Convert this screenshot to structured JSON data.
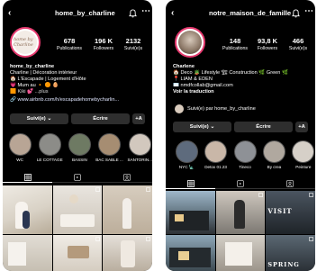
{
  "left": {
    "handle": "home_by_charline",
    "avatar_text": "home by Charline",
    "stats": [
      {
        "value": "678",
        "label": "Publications"
      },
      {
        "value": "196 K",
        "label": "Followers"
      },
      {
        "value": "2132",
        "label": "Suivi(e)s"
      }
    ],
    "bio": {
      "name": "home_by_charline",
      "lines": [
        "Charline | Décoration intérieur",
        "🏠 L'Escapade | Logement d'Hôte",
        "💗 Mum au 🔸 🟠 🥚",
        "🟧 Kiki 💕 ...plus"
      ],
      "link": "www.airbnb.com/h/escapadehomebycharlin..."
    },
    "buttons": {
      "follow": "Suivi(e) ⌄",
      "message": "Écrire",
      "add": "+A"
    },
    "highlights": [
      {
        "label": "WC",
        "color": "#b8a595"
      },
      {
        "label": "LE COTTAGE",
        "color": "#8c8c88"
      },
      {
        "label": "BASSIN",
        "color": "#6e7a63"
      },
      {
        "label": "BAC SABLE ...",
        "color": "#a68d72"
      },
      {
        "label": "SANTORIN...",
        "color": "#d2c8be"
      }
    ]
  },
  "right": {
    "handle": "notre_maison_de_famille",
    "stats": [
      {
        "value": "148",
        "label": "Publications"
      },
      {
        "value": "93,8 K",
        "label": "Followers"
      },
      {
        "value": "466",
        "label": "Suivi(e)s"
      }
    ],
    "bio": {
      "name": "Charlene",
      "lines": [
        "🏠 Deco 🪴 Lifestyle 🏗 Construction 🌿 Green 🌿",
        "📍 LIAM & EDEN",
        "✉️ nmdfcollab@gmail.com"
      ],
      "translate": "Voir la traduction"
    },
    "followed_by": "Suivi(e) par home_by_charline",
    "buttons": {
      "follow": "Suivi(e) ⌄",
      "message": "Écrire",
      "add": "+A"
    },
    "highlights": [
      {
        "label": "NYC 🗽",
        "color": "#5e6b7d"
      },
      {
        "label": "Detox 01.23",
        "color": "#c9b7a8"
      },
      {
        "label": "Tineco",
        "color": "#8e9196"
      },
      {
        "label": "By crea",
        "color": "#b0a89f"
      },
      {
        "label": "Peinture",
        "color": "#d6d0c8"
      }
    ],
    "grid_caption_1": "VISIT",
    "grid_caption_2": "SPRING"
  }
}
